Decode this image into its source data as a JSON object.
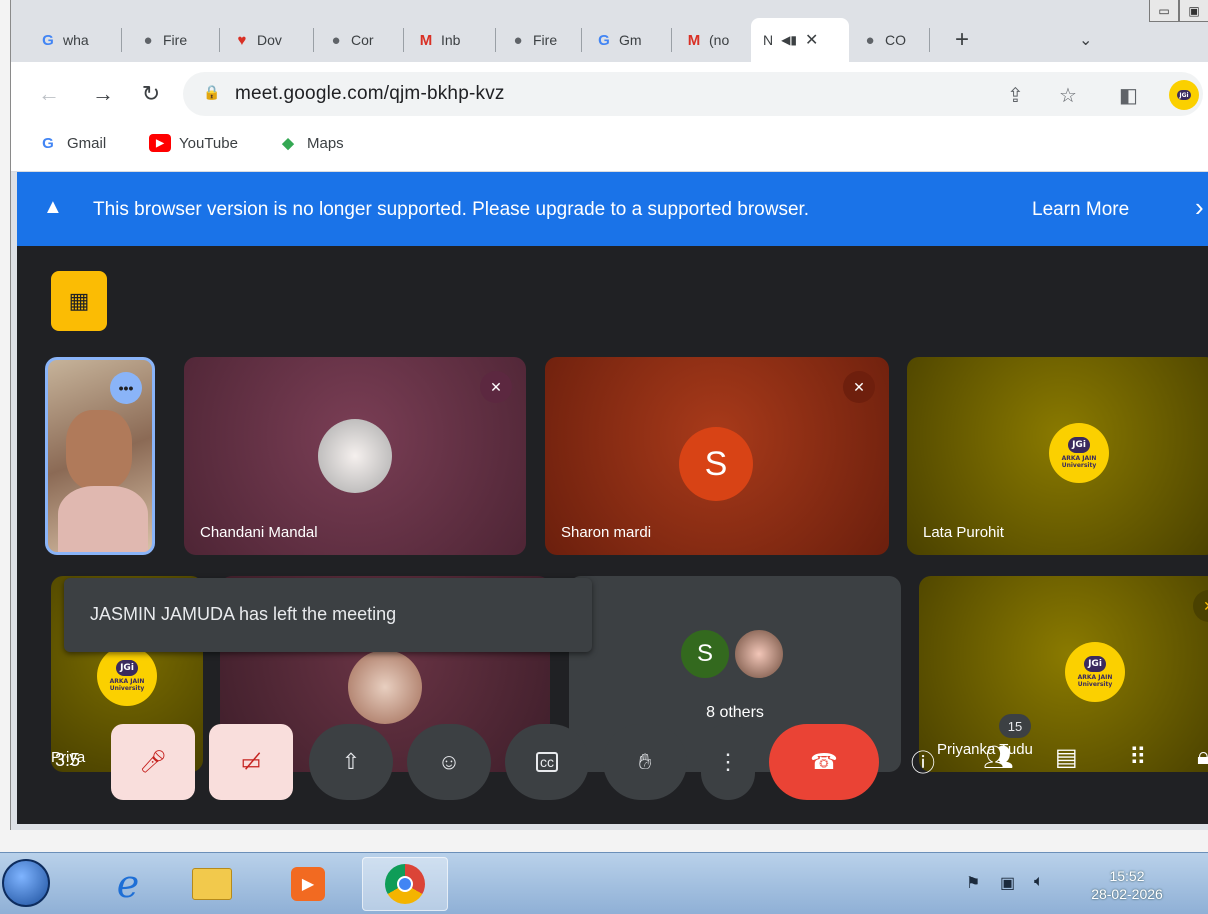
{
  "browser": {
    "tabs": [
      {
        "label": "wha",
        "icon": "google-icon"
      },
      {
        "label": "Fire",
        "icon": "chrome-icon"
      },
      {
        "label": "Dov",
        "icon": "heart-icon"
      },
      {
        "label": "Cor",
        "icon": "chrome-icon"
      },
      {
        "label": "Inb",
        "icon": "gmail-icon"
      },
      {
        "label": "Fire",
        "icon": "chrome-icon"
      },
      {
        "label": "Gm",
        "icon": "google-icon"
      },
      {
        "label": "(no",
        "icon": "gmail-icon"
      },
      {
        "label": "N",
        "icon": "meet-icon"
      },
      {
        "label": "CO",
        "icon": "chrome-icon"
      }
    ],
    "new_tab": "+",
    "url": "meet.google.com/qjm-bkhp-kvz",
    "bookmarks": [
      {
        "label": "Gmail",
        "icon": "google-icon"
      },
      {
        "label": "YouTube",
        "icon": "youtube-icon"
      },
      {
        "label": "Maps",
        "icon": "maps-icon"
      }
    ]
  },
  "banner": {
    "message": "This browser version is no longer supported. Please upgrade to a supported browser.",
    "link": "Learn More"
  },
  "meet": {
    "participants": [
      {
        "name": "Chandani Mandal",
        "avatar": "photo"
      },
      {
        "name": "Sharon mardi",
        "avatar_letter": "S"
      },
      {
        "name": "Lata Purohit",
        "avatar": "jgi-logo"
      },
      {
        "name": "Priyanka Tudu",
        "avatar": "jgi-logo"
      }
    ],
    "others_letter": "S",
    "others_label": "8 others",
    "toast": "JASMIN JAMUDA has left the meeting",
    "people_count": "15",
    "time_partial": "3:5",
    "partial_names": [
      "Priya",
      "i"
    ],
    "logo": {
      "short": "JGi",
      "line1": "ARKA JAIN",
      "line2": "University"
    }
  },
  "taskbar": {
    "time": "15:52",
    "date": "28-02-2026"
  }
}
